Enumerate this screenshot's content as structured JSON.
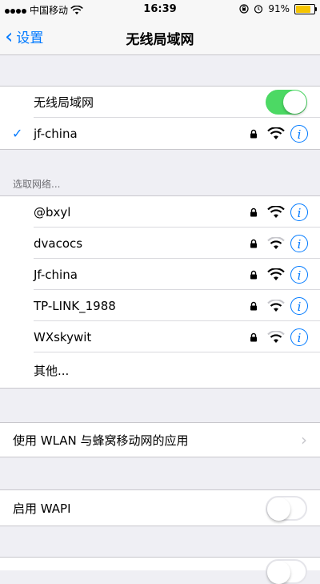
{
  "status_bar": {
    "carrier": "中国移动",
    "time": "16:39",
    "battery": "91%",
    "battery_level": 0.91,
    "icons": [
      "signal-icon",
      "wifi-icon",
      "orientation-lock-icon",
      "alarm-icon",
      "battery-icon"
    ]
  },
  "nav": {
    "back_label": "设置",
    "title": "无线局域网"
  },
  "wifi_toggle": {
    "label": "无线局域网",
    "on": true
  },
  "connected": {
    "name": "jf-china",
    "secured": true
  },
  "section_header": "选取网络...",
  "networks": [
    {
      "name": "@bxyl",
      "secured": true
    },
    {
      "name": "dvacocs",
      "secured": true
    },
    {
      "name": "Jf-china",
      "secured": true
    },
    {
      "name": "TP-LINK_1988",
      "secured": true
    },
    {
      "name": "WXskywit",
      "secured": true
    }
  ],
  "other_label": "其他...",
  "wlan_apps_label": "使用 WLAN 与蜂窝移动网的应用",
  "wapi": {
    "label": "启用 WAPI",
    "on": false
  },
  "colors": {
    "accent": "#007aff",
    "toggle_on": "#4cd964",
    "background": "#efeff4"
  }
}
